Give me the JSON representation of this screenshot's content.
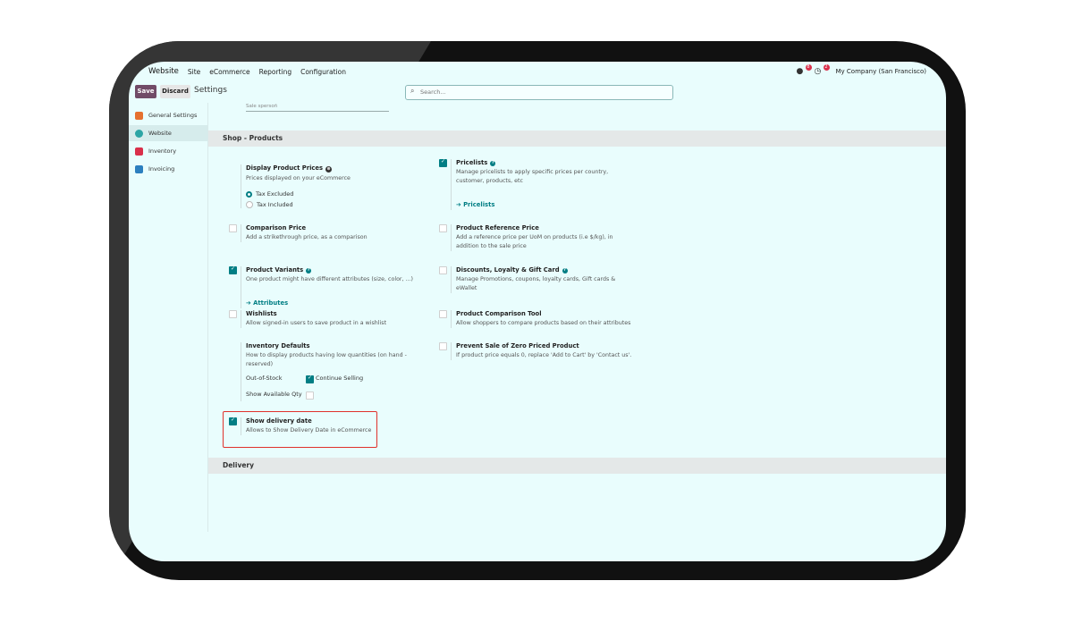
{
  "topnav": {
    "app_name": "Website",
    "menus": [
      "Site",
      "eCommerce",
      "Reporting",
      "Configuration"
    ],
    "messages_badge": "8",
    "activity_badge": "2",
    "company": "My Company (San Francisco)"
  },
  "controlbar": {
    "save_label": "Save",
    "discard_label": "Discard",
    "breadcrumb": "Settings",
    "search_placeholder": "Search..."
  },
  "sidebar": {
    "items": [
      {
        "label": "General Settings",
        "color": "#e5712f"
      },
      {
        "label": "Website",
        "color": "#2ca5a5"
      },
      {
        "label": "Inventory",
        "color": "#d9304b"
      },
      {
        "label": "Invoicing",
        "color": "#2b7fbf"
      }
    ]
  },
  "content": {
    "stub_label": "Sale spersoñ",
    "section_shop": "Shop - Products",
    "section_delivery": "Delivery",
    "display_prices": {
      "title": "Display Product Prices",
      "desc": "Prices displayed on your eCommerce",
      "option_excluded": "Tax Excluded",
      "option_included": "Tax Included"
    },
    "pricelists": {
      "title": "Pricelists",
      "desc": "Manage pricelists to apply specific prices per country, customer, products, etc",
      "link": "Pricelists",
      "checked": true
    },
    "comparison_price": {
      "title": "Comparison Price",
      "desc": "Add a strikethrough price, as a comparison",
      "checked": false
    },
    "product_ref_price": {
      "title": "Product Reference Price",
      "desc": "Add a reference price per UoM on products (i.e $/kg), in addition to the sale price",
      "checked": false
    },
    "product_variants": {
      "title": "Product Variants",
      "desc": "One product might have different attributes (size, color, ...)",
      "link": "Attributes",
      "checked": true
    },
    "discounts": {
      "title": "Discounts, Loyalty & Gift Card",
      "desc": "Manage Promotions, coupons, loyalty cards, Gift cards & eWallet",
      "checked": false
    },
    "wishlists": {
      "title": "Wishlists",
      "desc": "Allow signed-in users to save product in a wishlist",
      "checked": false
    },
    "comparison_tool": {
      "title": "Product Comparison Tool",
      "desc": "Allow shoppers to compare products based on their attributes",
      "checked": false
    },
    "inventory_defaults": {
      "title": "Inventory Defaults",
      "desc": "How to display products having low quantities (on hand - reserved)",
      "out_of_stock_label": "Out-of-Stock",
      "continue_selling_label": "Continue Selling",
      "continue_selling_checked": true,
      "show_available_label": "Show Available Qty",
      "show_available_checked": false
    },
    "zero_priced": {
      "title": "Prevent Sale of Zero Priced Product",
      "desc": "If product price equals 0, replace 'Add to Cart' by 'Contact us'.",
      "checked": false
    },
    "delivery_date": {
      "title": "Show delivery date",
      "desc": "Allows to Show Delivery Date in eCommerce",
      "checked": true
    }
  }
}
